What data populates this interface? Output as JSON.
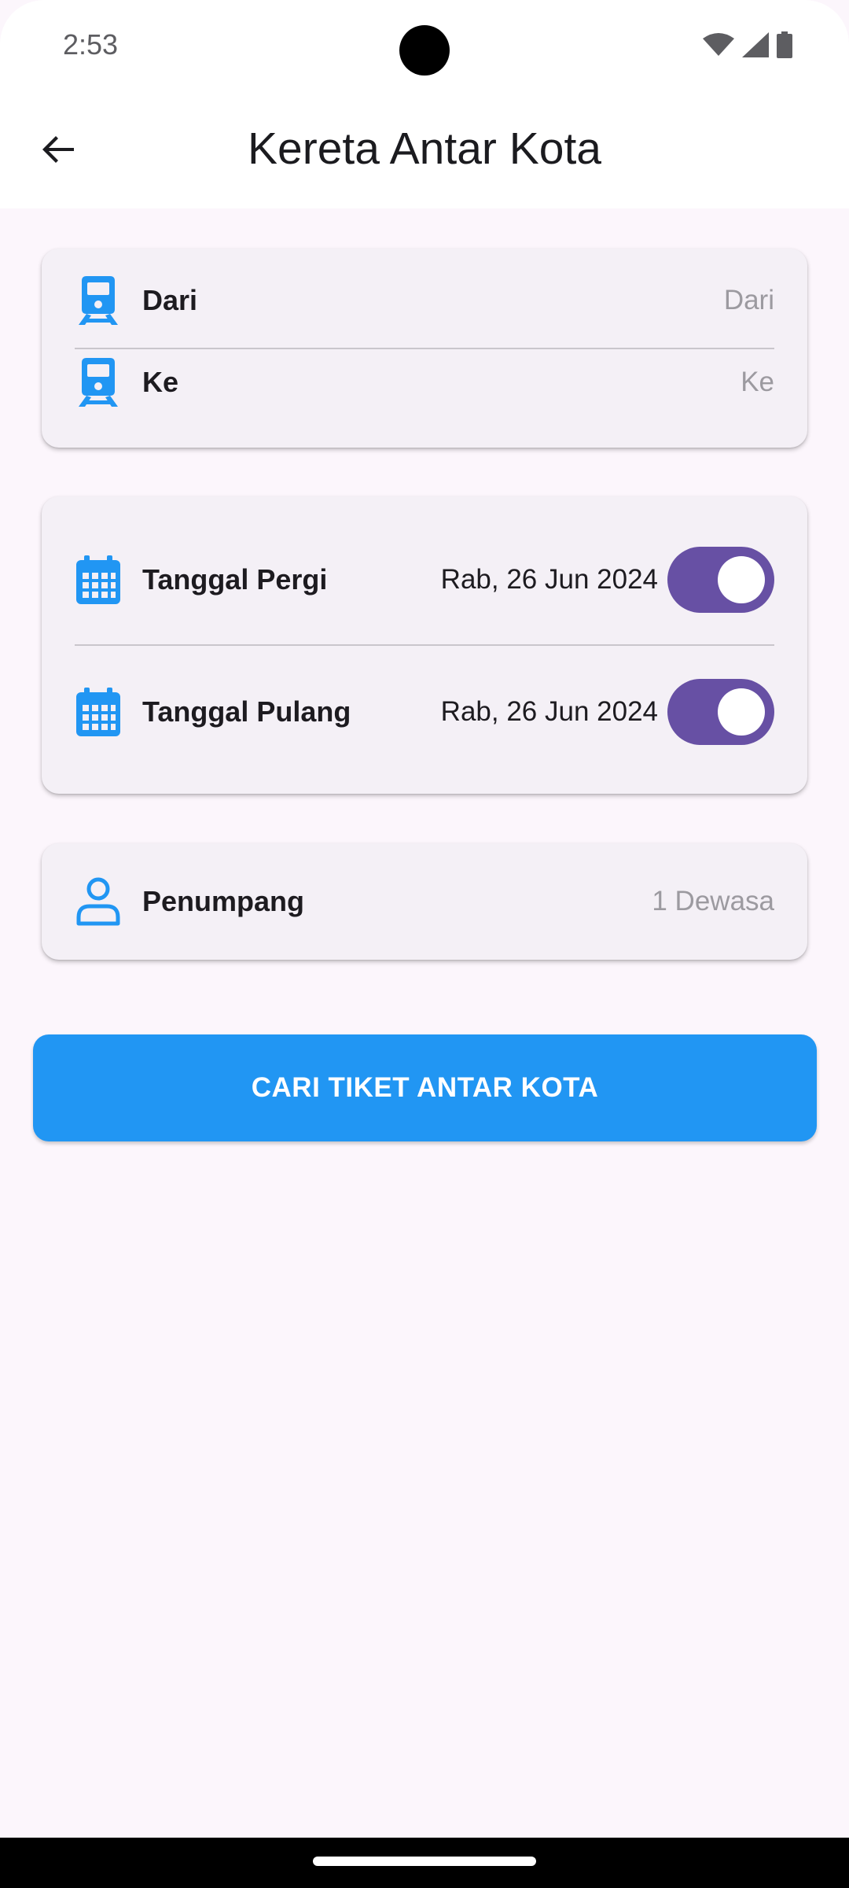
{
  "status_bar": {
    "time": "2:53",
    "icons": [
      "wifi-icon",
      "signal-icon",
      "battery-icon"
    ]
  },
  "app_bar": {
    "title": "Kereta Antar Kota",
    "back_icon": "arrow-back-icon"
  },
  "route_card": {
    "from": {
      "label": "Dari",
      "value": "Dari",
      "icon": "train-icon"
    },
    "to": {
      "label": "Ke",
      "value": "Ke",
      "icon": "train-icon"
    }
  },
  "date_card": {
    "depart": {
      "label": "Tanggal Pergi",
      "value": "Rab, 26 Jun 2024",
      "icon": "calendar-icon",
      "toggle_on": true
    },
    "return": {
      "label": "Tanggal Pulang",
      "value": "Rab, 26 Jun 2024",
      "icon": "calendar-icon",
      "toggle_on": true
    }
  },
  "passenger_card": {
    "label": "Penumpang",
    "value": "1 Dewasa",
    "icon": "person-icon"
  },
  "search_button": {
    "label": "CARI TIKET ANTAR KOTA"
  },
  "colors": {
    "accent": "#2196f3",
    "toggle": "#6750a4",
    "background": "#fcf6fc",
    "card": "#f4f0f6"
  }
}
